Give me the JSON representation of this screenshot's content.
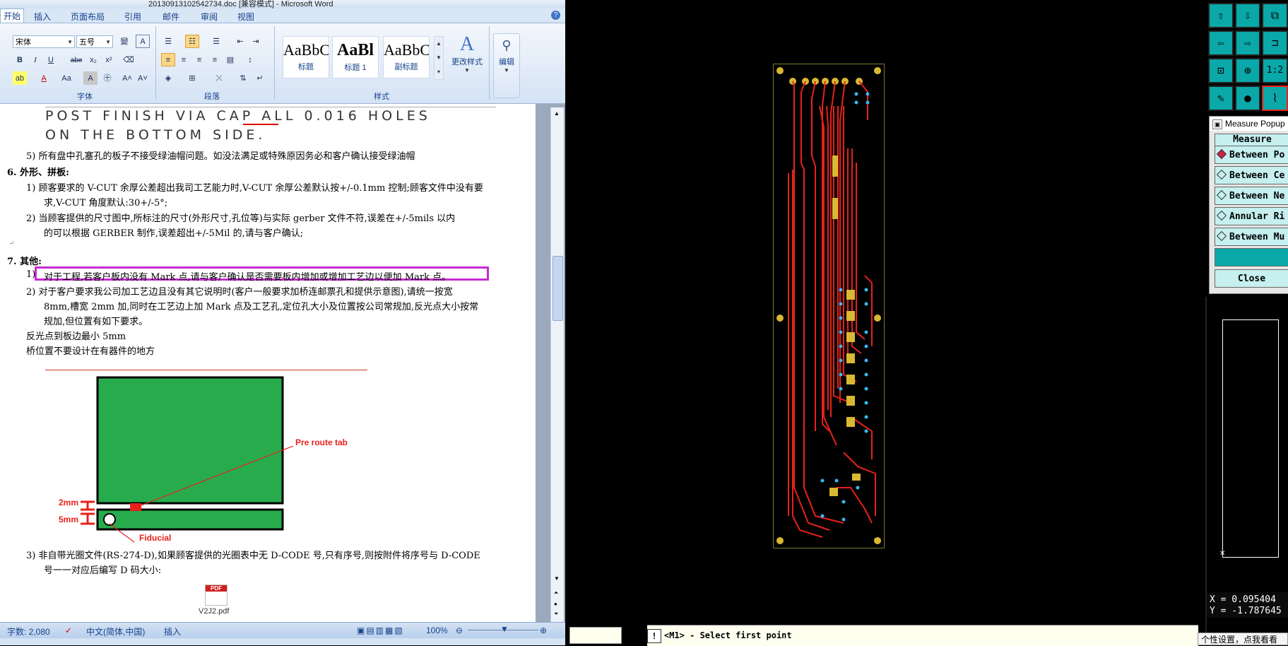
{
  "word": {
    "window_title": "20130913102542734.doc [兼容模式] - Microsoft Word",
    "tabs": [
      "开始",
      "插入",
      "页面布局",
      "引用",
      "邮件",
      "审阅",
      "视图"
    ],
    "font_name": "宋体",
    "font_size": "五号",
    "group_font": "字体",
    "group_paragraph": "段落",
    "group_styles": "样式",
    "group_edit": "编辑",
    "styles": [
      {
        "sample": "AaBbC",
        "name": "标题"
      },
      {
        "sample": "AaBl",
        "name": "标题 1"
      },
      {
        "sample": "AaBbC",
        "name": "副标题"
      }
    ],
    "change_styles": "更改样式",
    "doc": {
      "post_line1": "POST FINISH VIA CAP ALL 0.016 HOLES",
      "post_line2": "ON THE BOTTOM SIDE.",
      "l5": "5) 所有盘中孔塞孔的板子不接受绿油帽问题。如没法满足或特殊原因务必和客户确认接受绿油帽",
      "h6": "6.   外形、拼板:",
      "l6_1a": "1)  顾客要求的 V-CUT 余厚公差超出我司工艺能力时,V-CUT 余厚公差默认按+/-0.1mm 控制;顾客文件中没有要",
      "l6_1b": "求,V-CUT 角度默认:30+/-5°;",
      "l6_2a": "2)  当顾客提供的尺寸图中,所标注的尺寸(外形尺寸,孔位等)与实际 gerber 文件不符,误差在+/-5mils 以内",
      "l6_2b": "的可以根据 GERBER 制作,误差超出+/-5Mil 的,请与客户确认;",
      "h7": "7.   其他:",
      "l7_1": "对于工程,若客户板内没有 Mark 点,请与客户确认是否需要板内增加或增加工艺边以便加 Mark 点。",
      "l7_1_num": "1)",
      "l7_2a": "2)  对于客户要求我公司加工艺边且没有其它说明时(客户一般要求加桥连邮票孔和提供示意图),请统一按宽",
      "l7_2b": "8mm,槽宽 2mm 加,同时在工艺边上加 Mark 点及工艺孔,定位孔大小及位置按公司常规加,反光点大小按常",
      "l7_2c": "规加,但位置有如下要求。",
      "rule1": "反光点到板边最小 5mm",
      "rule2": "桥位置不要设计在有器件的地方",
      "fig_pre_route": "Pre route tab",
      "fig_2mm": "2mm",
      "fig_5mm": "5mm",
      "fig_fiducial": "Fiducial",
      "l3a": "3)  非自带光圈文件(RS-274-D),如果顾客提供的光圈表中无 D-CODE 号,只有序号,则按附件将序号与 D-CODE",
      "l3b": "号一一对应后编写 D 码大小:",
      "attachment": "V2J2.pdf",
      "pdf_label": "PDF"
    },
    "status": {
      "word_count": "字数: 2,080",
      "language": "中文(简体,中国)",
      "mode": "插入",
      "zoom": "100%"
    }
  },
  "cam": {
    "command_prompt": "<M1> - Select first point",
    "measure_title": "Measure Popup",
    "measure_header": "Measure",
    "measure_options": [
      "Between Po",
      "Between Ce",
      "Between Ne",
      "Annular Ri",
      "Between Mu"
    ],
    "close_label": "Close",
    "coord_x": "X = 0.095404",
    "coord_y": "Y = -1.787645",
    "tool_label": "1:2",
    "tooltip": "个性设置，点我看看"
  },
  "colors": {
    "pcb_trace": "#e8211b",
    "pcb_pad": "#d9b832",
    "pcb_via": "#39b8f0",
    "highlight_box": "#c82bd1",
    "fig_green": "#27ab4d",
    "cam_tool": "#0aa8a8"
  }
}
